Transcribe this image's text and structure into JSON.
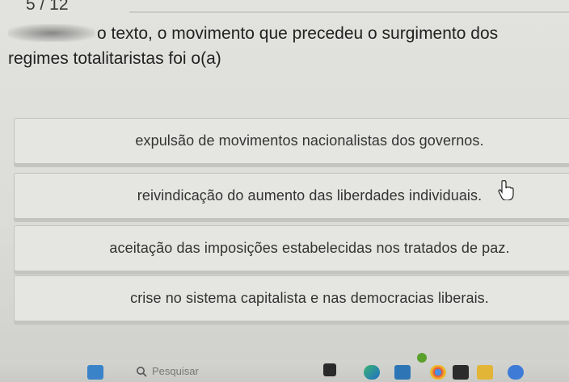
{
  "header": {
    "question_counter": "5 / 12"
  },
  "question": {
    "text_visible": "o texto, o movimento que precedeu o surgimento dos regimes totalitaristas foi o(a)"
  },
  "options": [
    {
      "label": "expulsão de movimentos nacionalistas dos governos."
    },
    {
      "label": "reivindicação do aumento das liberdades individuais."
    },
    {
      "label": "aceitação das imposições estabelecidas nos tratados de paz."
    },
    {
      "label": "crise no sistema capitalista e nas democracias liberais."
    }
  ],
  "taskbar": {
    "search_placeholder": "Pesquisar",
    "icons": [
      "windows-start-icon",
      "search-icon",
      "file-explorer-icon",
      "edge-browser-icon",
      "store-icon",
      "chrome-icon",
      "app-icon",
      "folder-icon",
      "maps-icon"
    ]
  }
}
